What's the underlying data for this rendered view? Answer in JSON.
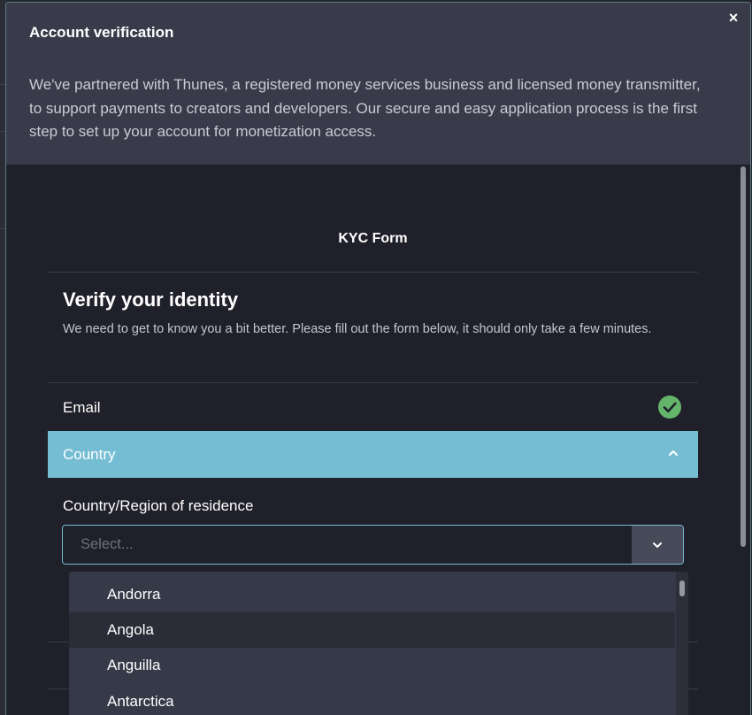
{
  "modal": {
    "title": "Account verification",
    "description": "We've partnered with Thunes, a registered money services business and licensed money transmitter, to support payments to creators and developers. Our secure and easy application process is the first step to set up your account for monetization access.",
    "close_label": "×"
  },
  "form": {
    "title": "KYC Form",
    "verify_title": "Verify your identity",
    "verify_description": "We need to get to know you a bit better. Please fill out the form below, it should only take a few minutes.",
    "sections": {
      "email": {
        "label": "Email",
        "status": "complete",
        "status_icon": "check-circle-icon"
      },
      "country": {
        "label": "Country",
        "expanded": true,
        "toggle_icon": "chevron-up-icon"
      }
    },
    "country_field": {
      "label": "Country/Region of residence",
      "placeholder": "Select...",
      "value": "",
      "toggle_icon": "chevron-down-icon",
      "options": [
        "Andorra",
        "Angola",
        "Anguilla",
        "Antarctica"
      ],
      "highlighted_option": "Angola"
    }
  },
  "colors": {
    "accent": "#75bdd3",
    "success": "#64b46c",
    "header_bg": "#393b4a",
    "body_bg": "#1f2029"
  }
}
